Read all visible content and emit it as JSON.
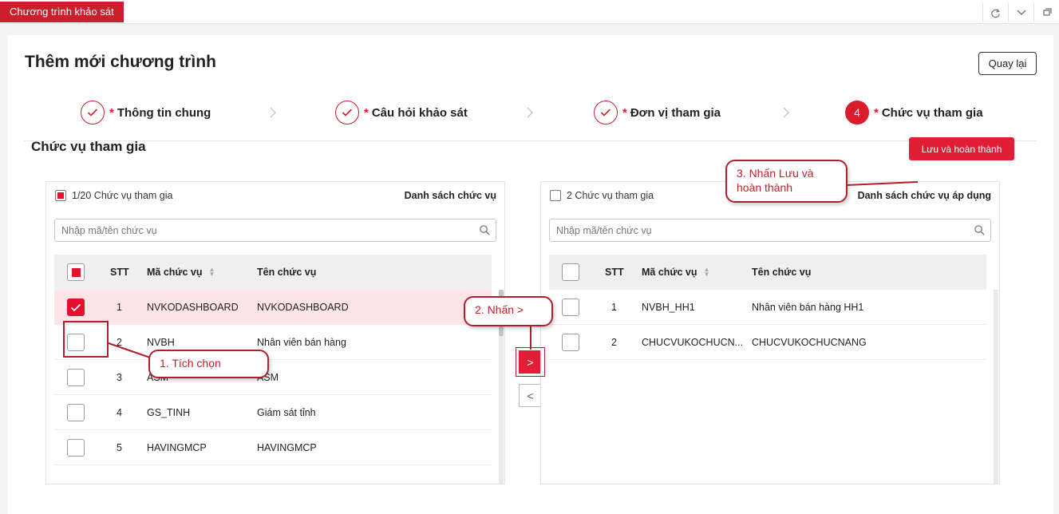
{
  "app_tab": "Chương trình khảo sát",
  "page_title": "Thêm mới chương trình",
  "back_label": "Quay lại",
  "steps": [
    {
      "label": "Thông tin chung",
      "star": "*",
      "state": "done"
    },
    {
      "label": "Câu hỏi khảo sát",
      "star": "*",
      "state": "done"
    },
    {
      "label": "Đơn vị tham gia",
      "star": "*",
      "state": "done"
    },
    {
      "label": "Chức vụ tham gia",
      "star": "*",
      "state": "active",
      "number": "4"
    }
  ],
  "section_title": "Chức vụ tham gia",
  "save_label": "Lưu và hoàn thành",
  "left_panel": {
    "count_label": "1/20 Chức vụ tham gia",
    "title": "Danh sách chức vụ",
    "search_placeholder": "Nhập mã/tên chức vụ",
    "columns": {
      "stt": "STT",
      "code": "Mã chức vụ",
      "name": "Tên chức vụ"
    },
    "rows": [
      {
        "stt": "1",
        "code": "NVKODASHBOARD",
        "name": "NVKODASHBOARD",
        "checked": true
      },
      {
        "stt": "2",
        "code": "NVBH",
        "name": "Nhân viên bán hàng",
        "checked": false
      },
      {
        "stt": "3",
        "code": "ASM",
        "name": "ASM",
        "checked": false
      },
      {
        "stt": "4",
        "code": "GS_TINH",
        "name": "Giám sát tỉnh",
        "checked": false
      },
      {
        "stt": "5",
        "code": "HAVINGMCP",
        "name": "HAVINGMCP",
        "checked": false
      }
    ]
  },
  "right_panel": {
    "count_label": "2 Chức vụ tham gia",
    "title": "Danh sách chức vụ áp dụng",
    "search_placeholder": "Nhập mã/tên chức vụ",
    "columns": {
      "stt": "STT",
      "code": "Mã chức vụ",
      "name": "Tên chức vụ"
    },
    "rows": [
      {
        "stt": "1",
        "code": "NVBH_HH1",
        "name": "Nhân viên bán hàng HH1",
        "checked": false
      },
      {
        "stt": "2",
        "code": "CHUCVUKOCHUCN...",
        "name": "CHUCVUKOCHUCNANG",
        "checked": false
      }
    ]
  },
  "move_right_label": ">",
  "move_left_label": "<",
  "annotations": {
    "step1": "1. Tích chọn",
    "step2": "2. Nhấn >",
    "step3_line1": "3. Nhấn Lưu và",
    "step3_line2": "hoàn thành"
  },
  "icons": {
    "refresh": "refresh-icon",
    "chevron_down": "chevron-down-icon",
    "window": "window-icon",
    "search": "search-icon",
    "check": "check-icon",
    "sort": "sort-icon"
  },
  "colors": {
    "brand_red": "#cc1f2d",
    "button_red": "#e21d36",
    "selected_row": "#fde4e6",
    "annotation_red": "#b01f2a"
  }
}
